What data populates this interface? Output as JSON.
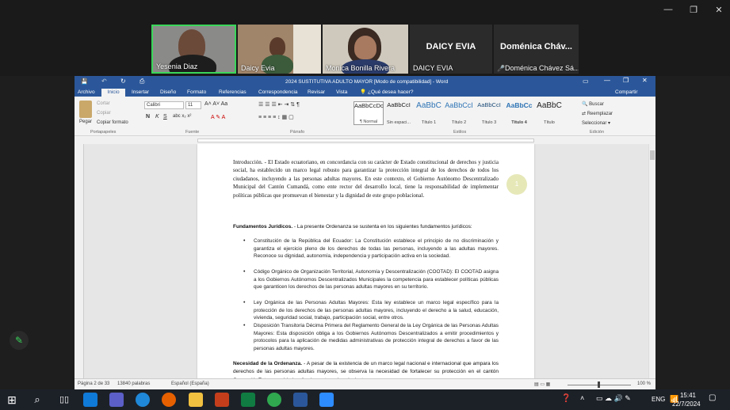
{
  "participants": [
    {
      "name": "Yesenia Diaz"
    },
    {
      "name": "Daicy Evia"
    },
    {
      "name": "Monica Bonilla Rivera"
    },
    {
      "name": "DAICY EVIA",
      "caption": "DAICY EVIA"
    },
    {
      "name": "Doménica Cháv...",
      "caption": "Doménica Chávez Sá..."
    }
  ],
  "window": {
    "title": "2024 SUSTITUTIVA ADULTO MAYOR [Modo de compatibilidad] - Word",
    "share": "Compartir",
    "tell": "¿Qué desea hacer?"
  },
  "tabs": [
    "Archivo",
    "Inicio",
    "Insertar",
    "Diseño",
    "Formato",
    "Referencias",
    "Revisar",
    "Vista"
  ],
  "ribbon": {
    "paste": "Pegar",
    "cut": "Cortar",
    "copy": "Copiar",
    "format_painter": "Copiar formato",
    "font": "Calibri",
    "size": "11",
    "groups": [
      "Portapapeles",
      "Fuente",
      "Párrafo",
      "Estilos",
      "Edición"
    ],
    "styles": [
      {
        "preview": "AaBbCcDc",
        "label": "¶ Normal"
      },
      {
        "preview": "AaBbCcI",
        "label": "Sin espaci..."
      },
      {
        "preview": "AaBbC",
        "label": "Título 1"
      },
      {
        "preview": "AaBbCcI",
        "label": "Título 2"
      },
      {
        "preview": "AaBbCcI",
        "label": "Título 3"
      },
      {
        "preview": "AaBbCc",
        "label": "Título 4"
      },
      {
        "preview": "AaBbC",
        "label": "Título"
      }
    ],
    "search": "Buscar",
    "replace": "Reemplazar",
    "select": "Seleccionar"
  },
  "doc": {
    "intro": "Introducción. - El Estado ecuatoriano, en concordancia con su carácter de Estado constitucional de derechos y justicia social, ha establecido un marco legal robusto para garantizar la protección integral de los derechos de todos los ciudadanos, incluyendo a las personas adultas mayores. En este contexto, el Gobierno Autónomo Descentralizado Municipal del Cantón Cumandá, como ente rector del desarrollo local, tiene la responsabilidad de implementar políticas públicas que promuevan el bienestar y la dignidad de este grupo poblacional.",
    "fund_head": "Fundamentos Jurídicos.",
    "fund_text": " - La presente Ordenanza se sustenta en los siguientes fundamentos jurídicos:",
    "bullets": [
      "Constitución de la República del Ecuador: La Constitución establece el principio de no discriminación y garantiza el ejercicio pleno de los derechos de todas las personas, incluyendo a las adultas mayores. Reconoce su dignidad, autonomía, independencia y participación activa en la sociedad.",
      "Código Orgánico de Organización Territorial, Autonomía y Descentralización (COOTAD): El COOTAD asigna a los Gobiernos Autónomos Descentralizados Municipales la competencia para establecer políticas públicas que garanticen los derechos de las personas adultas mayores en su territorio.",
      "Ley Orgánica de las Personas Adultas Mayores: Esta ley establece un marco legal específico para la protección de los derechos de las personas adultas mayores, incluyendo el derecho a la salud, educación, vivienda, seguridad social, trabajo, participación social, entre otros.",
      "Disposición Transitoria Décima Primera del Reglamento General de la Ley Orgánica de las Personas Adultas Mayores: Esta disposición obliga a los Gobiernos Autónomos Descentralizados a emitir procedimientos y protocolos para la aplicación de medidas administrativas de protección integral de derechos a favor de las personas adultas mayores."
    ],
    "need_head": "Necesidad de la Ordenanza.",
    "need_text": " - A pesar de la existencia de un marco legal nacional e internacional que ampara los derechos de las personas adultas mayores, se observa la necesidad de fortalecer su protección en el cantón Cumandá. Esta necesidad se fundamenta en los siguientes razones:",
    "marker": "1"
  },
  "status": {
    "page": "Página 2 de 33",
    "words": "13840 palabras",
    "lang": "Español (España)",
    "zoom": "100 %"
  },
  "clock": {
    "time": "15:41",
    "date": "22/7/2024",
    "lang": "ENG"
  }
}
